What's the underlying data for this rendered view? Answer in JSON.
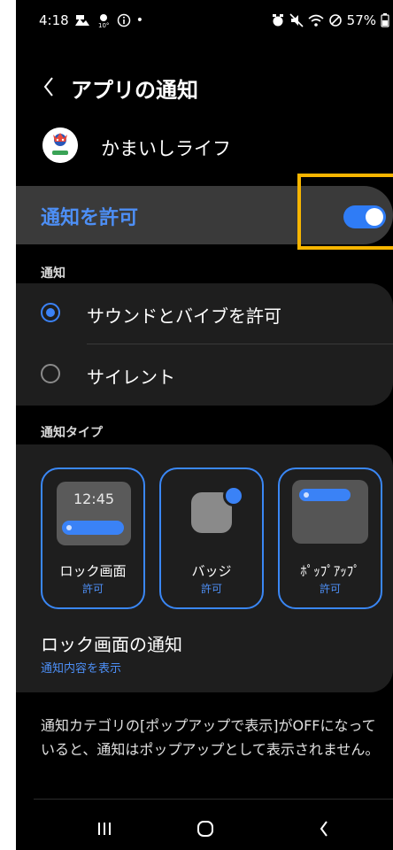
{
  "status_bar": {
    "time": "4:18",
    "battery": "57%",
    "left_icons": [
      "photo-notif-icon",
      "weather-icon",
      "info-icon",
      "dot-icon"
    ],
    "right_icons": [
      "alarm-icon",
      "mute-icon",
      "wifi-icon",
      "do-not-disturb-icon",
      "battery-icon"
    ]
  },
  "header": {
    "title": "アプリの通知"
  },
  "app": {
    "name": "かまいしライフ"
  },
  "allow": {
    "label": "通知を許可",
    "enabled": true
  },
  "notification_section": {
    "label": "通知",
    "options": [
      {
        "label": "サウンドとバイブを許可",
        "selected": true
      },
      {
        "label": "サイレント",
        "selected": false
      }
    ]
  },
  "type_section": {
    "label": "通知タイプ",
    "tiles": [
      {
        "name": "ロック画面",
        "status": "許可",
        "preview_time": "12:45"
      },
      {
        "name": "バッジ",
        "status": "許可"
      },
      {
        "name": "ﾎﾟｯﾌﾟｱｯﾌﾟ",
        "status": "許可"
      }
    ]
  },
  "lockscreen": {
    "title": "ロック画面の通知",
    "subtitle": "通知内容を表示"
  },
  "info": {
    "text": "通知カテゴリの[ポップアップで表示]がOFFになっていると、通知はポップアップとして表示されません。"
  },
  "colors": {
    "accent": "#2f7cf6",
    "highlight": "#f7b500",
    "background": "#000000",
    "card": "#1e1e1e"
  }
}
